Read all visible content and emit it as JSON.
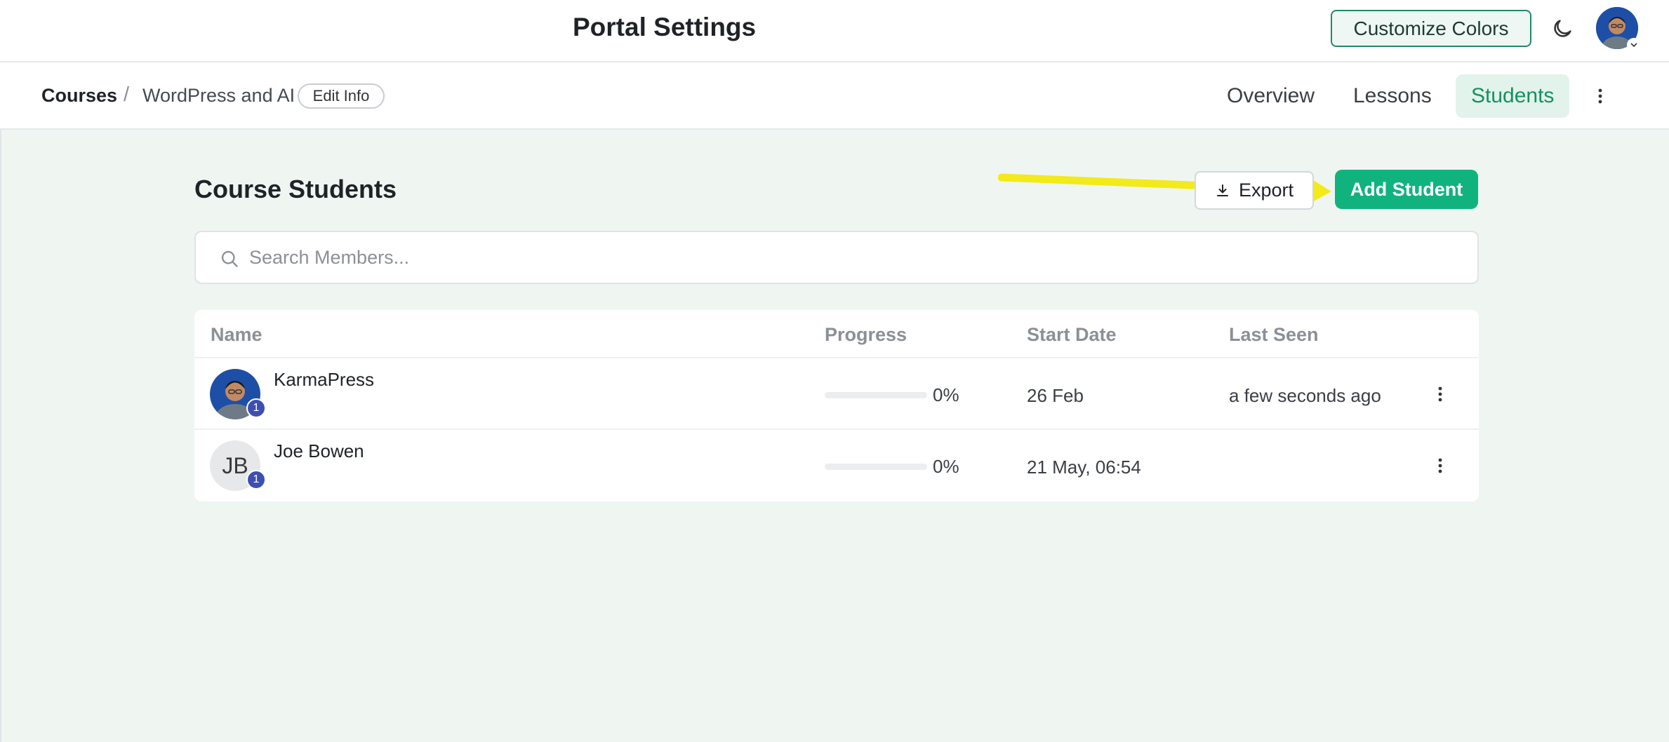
{
  "header": {
    "title": "Portal Settings",
    "customize_label": "Customize Colors",
    "theme_icon": "moon-icon"
  },
  "breadcrumb": {
    "root": "Courses",
    "separator": "/",
    "course": "WordPress and AI",
    "edit_label": "Edit Info"
  },
  "tabs": [
    {
      "label": "Overview",
      "active": false
    },
    {
      "label": "Lessons",
      "active": false
    },
    {
      "label": "Students",
      "active": true
    }
  ],
  "main": {
    "title": "Course Students",
    "export_label": "Export",
    "add_label": "Add Student",
    "search_placeholder": "Search Members...",
    "columns": [
      "Name",
      "Progress",
      "Start Date",
      "Last Seen"
    ],
    "students": [
      {
        "name": "KarmaPress",
        "avatar": "photo",
        "badge": "1",
        "progress_pct": 0,
        "progress_label": "0%",
        "start_date": "26 Feb",
        "last_seen": "a few seconds ago"
      },
      {
        "name": "Joe Bowen",
        "avatar": "JB",
        "badge": "1",
        "progress_pct": 0,
        "progress_label": "0%",
        "start_date": "21 May, 06:54",
        "last_seen": ""
      }
    ]
  },
  "colors": {
    "accent": "#10b37d",
    "accent_text": "#17915f",
    "accent_tab_bg": "#e2f3ec",
    "page_bg": "#eff6f2",
    "annotation_arrow": "#f2ea1a",
    "badge": "#3d4fb0"
  }
}
